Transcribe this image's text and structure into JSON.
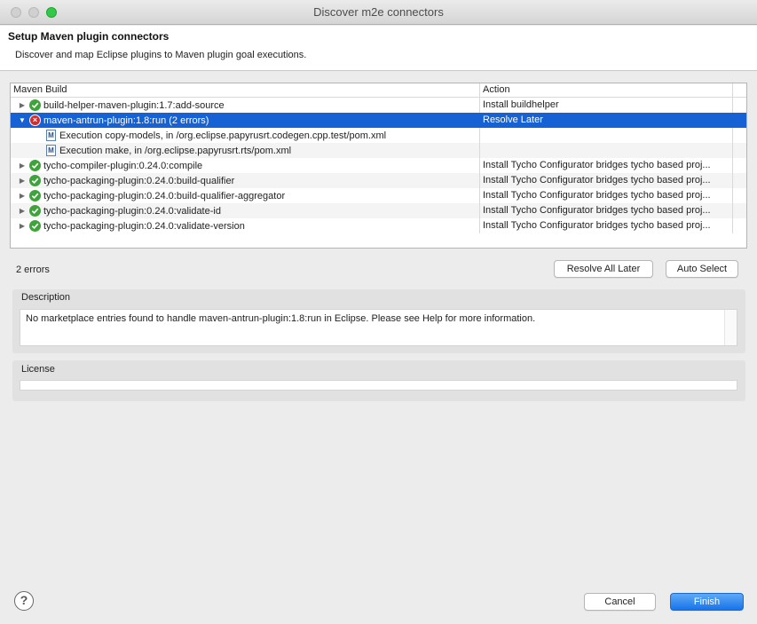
{
  "window": {
    "title": "Discover m2e connectors"
  },
  "header": {
    "title": "Setup Maven plugin connectors",
    "description": "Discover and map Eclipse plugins to Maven plugin goal executions."
  },
  "table": {
    "columns": [
      "Maven Build",
      "Action"
    ],
    "rows": [
      {
        "label": "build-helper-maven-plugin:1.7:add-source",
        "action": "Install buildhelper",
        "status": "ok",
        "expanded": false
      },
      {
        "label": "maven-antrun-plugin:1.8:run (2 errors)",
        "action": "Resolve Later",
        "status": "error",
        "expanded": true,
        "selected": true
      },
      {
        "label": "Execution copy-models, in /org.eclipse.papyrusrt.codegen.cpp.test/pom.xml",
        "action": "",
        "status": "pom",
        "child": true
      },
      {
        "label": "Execution make, in /org.eclipse.papyrusrt.rts/pom.xml",
        "action": "",
        "status": "pom",
        "child": true
      },
      {
        "label": "tycho-compiler-plugin:0.24.0:compile",
        "action": "Install Tycho Configurator bridges tycho based proj...",
        "status": "ok",
        "expanded": false
      },
      {
        "label": "tycho-packaging-plugin:0.24.0:build-qualifier",
        "action": "Install Tycho Configurator bridges tycho based proj...",
        "status": "ok",
        "expanded": false
      },
      {
        "label": "tycho-packaging-plugin:0.24.0:build-qualifier-aggregator",
        "action": "Install Tycho Configurator bridges tycho based proj...",
        "status": "ok",
        "expanded": false
      },
      {
        "label": "tycho-packaging-plugin:0.24.0:validate-id",
        "action": "Install Tycho Configurator bridges tycho based proj...",
        "status": "ok",
        "expanded": false
      },
      {
        "label": "tycho-packaging-plugin:0.24.0:validate-version",
        "action": "Install Tycho Configurator bridges tycho based proj...",
        "status": "ok",
        "expanded": false
      }
    ]
  },
  "status": {
    "errors": "2 errors"
  },
  "buttons": {
    "resolve_all_later": "Resolve All Later",
    "auto_select": "Auto Select",
    "cancel": "Cancel",
    "finish": "Finish",
    "help": "?"
  },
  "description": {
    "label": "Description",
    "text": "No marketplace entries found to handle maven-antrun-plugin:1.8:run in Eclipse.  Please see Help for more information."
  },
  "license": {
    "label": "License",
    "text": ""
  },
  "colors": {
    "selection": "#1661d3",
    "ok": "#3fa33b",
    "error": "#d52b2b",
    "primary_button": "#1873e8"
  }
}
